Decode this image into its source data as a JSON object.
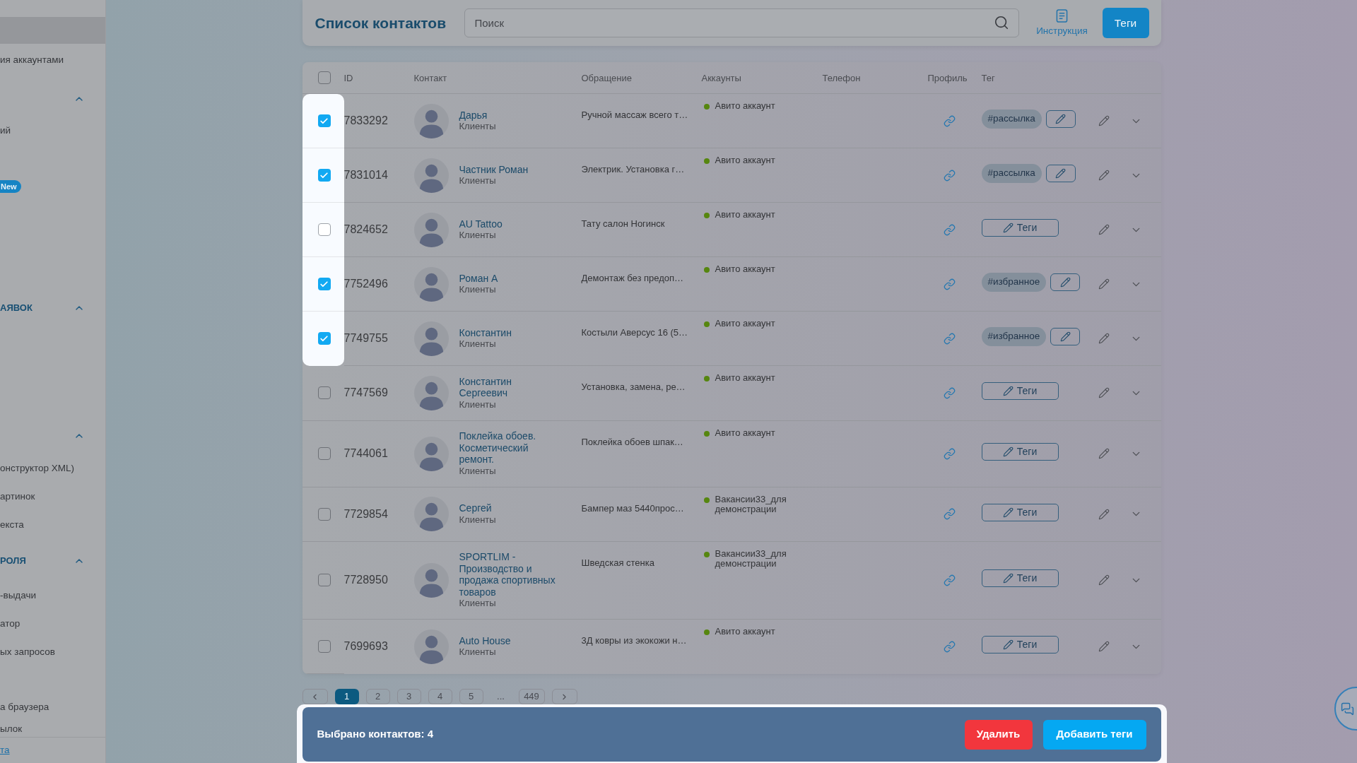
{
  "sidebar": {
    "entries": [
      {
        "kind": "item",
        "selected": true
      },
      {
        "kind": "item",
        "label": "ия аккаунтами",
        "selected": false
      },
      {
        "kind": "section",
        "expanded": true
      },
      {
        "kind": "item",
        "label": "ий",
        "selected": false
      },
      {
        "kind": "item",
        "badge": "New",
        "selected": false
      },
      {
        "kind": "section",
        "label": "АЯВОК",
        "expanded": true
      },
      {
        "kind": "section",
        "expanded": true
      },
      {
        "kind": "item",
        "label": "онструктор XML)",
        "selected": false
      },
      {
        "kind": "item",
        "label": "артинок",
        "selected": false
      },
      {
        "kind": "item",
        "label": "екста",
        "selected": false
      },
      {
        "kind": "section",
        "label": "РОЛЯ",
        "expanded": true
      },
      {
        "kind": "item",
        "label": "-выдачи",
        "selected": false
      },
      {
        "kind": "item",
        "label": "атор",
        "selected": false
      },
      {
        "kind": "item",
        "label": "ых запросов",
        "selected": false
      },
      {
        "kind": "item",
        "label": "а браузера",
        "selected": false
      },
      {
        "kind": "item",
        "label": "ылок",
        "selected": false
      }
    ],
    "footer_link": "та"
  },
  "header": {
    "title": "Список контактов",
    "search": {
      "placeholder": "Поиск"
    },
    "instructions_link": "Инструкция",
    "tags_button": "Теги"
  },
  "table": {
    "select_all": {
      "checked": false
    },
    "columns": [
      "ID",
      "Контакт",
      "Обращение",
      "Аккаунты",
      "Телефон",
      "Профиль",
      "Тег"
    ],
    "rows": [
      {
        "checked": true,
        "highlighted": true,
        "id": "7833292",
        "name": "Дарья",
        "group": "Клиенты",
        "request": "Ручной массаж всего т…",
        "account": "Авито аккаунт",
        "tags": [
          "#рассылка"
        ],
        "expanded": false
      },
      {
        "checked": true,
        "highlighted": true,
        "id": "7831014",
        "name": "Частник Роман",
        "group": "Клиенты",
        "request": "Электрик. Установка г…",
        "account": "Авито аккаунт",
        "tags": [
          "#рассылка"
        ],
        "expanded": false
      },
      {
        "checked": false,
        "highlighted": true,
        "id": "7824652",
        "name": "AU Tattoo",
        "group": "Клиенты",
        "request": "Тату салон Ногинск",
        "account": "Авито аккаунт",
        "tags_button": "Теги",
        "expanded": false
      },
      {
        "checked": true,
        "highlighted": true,
        "id": "7752496",
        "name": "Роман А",
        "group": "Клиенты",
        "request": "Демонтаж без предоп…",
        "account": "Авито аккаунт",
        "tags": [
          "#избранное"
        ],
        "expanded": false
      },
      {
        "checked": true,
        "highlighted": true,
        "id": "7749755",
        "name": "Константин",
        "group": "Клиенты",
        "request": "Костыли Аверсус 16 (5…",
        "account": "Авито аккаунт",
        "tags": [
          "#избранное"
        ],
        "expanded": false
      },
      {
        "checked": false,
        "highlighted": false,
        "id": "7747569",
        "name": "Константин Сергеевич",
        "group": "Клиенты",
        "request": "Установка, замена, ре…",
        "account": "Авито аккаунт",
        "tags_button": "Теги",
        "expanded": false
      },
      {
        "checked": false,
        "highlighted": false,
        "id": "7744061",
        "name": "Поклейка обоев. Косметический ремонт.",
        "group": "Клиенты",
        "request": "Поклейка обоев шпак…",
        "account": "Авито аккаунт",
        "tags_button": "Теги",
        "expanded": false
      },
      {
        "checked": false,
        "highlighted": false,
        "id": "7729854",
        "name": "Сергей",
        "group": "Клиенты",
        "request": "Бампер маз 5440прос…",
        "account": "Вакансии33_для демонстрации",
        "tags_button": "Теги",
        "expanded": false
      },
      {
        "checked": false,
        "highlighted": false,
        "id": "7728950",
        "name": "SPORTLIM - Производство и продажа спортивных товаров",
        "group": "Клиенты",
        "request": "Шведская стенка",
        "account": "Вакансии33_для демонстрации",
        "tags_button": "Теги",
        "expanded": false
      },
      {
        "checked": false,
        "highlighted": false,
        "id": "7699693",
        "name": "Auto House",
        "group": "Клиенты",
        "request": "3Д ковры из экокожи н…",
        "account": "Авито аккаунт",
        "tags_button": "Теги",
        "expanded": false
      }
    ]
  },
  "pagination": {
    "items": [
      {
        "kind": "page",
        "label": "1",
        "selected": true
      },
      {
        "kind": "page",
        "label": "2",
        "selected": false
      },
      {
        "kind": "page",
        "label": "3",
        "selected": false
      },
      {
        "kind": "page",
        "label": "4",
        "selected": false
      },
      {
        "kind": "page",
        "label": "5",
        "selected": false
      },
      {
        "kind": "ellipsis",
        "label": "..."
      },
      {
        "kind": "page",
        "label": "449",
        "selected": false
      }
    ]
  },
  "selection_bar": {
    "highlighted": true,
    "text": "Выбрано контактов: 4",
    "delete_button": "Удалить",
    "add_tags_button": "Добавить теги"
  }
}
